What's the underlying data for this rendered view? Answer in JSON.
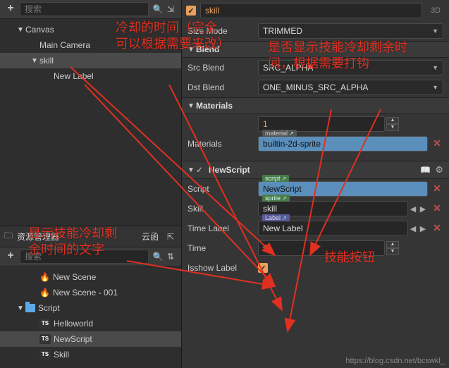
{
  "search": {
    "placeholder": "搜索"
  },
  "hierarchy": {
    "items": [
      {
        "label": "Canvas",
        "indent": 1,
        "caret": "▼"
      },
      {
        "label": "Main Camera",
        "indent": 2,
        "caret": ""
      },
      {
        "label": "skill",
        "indent": 2,
        "caret": "▼",
        "selected": true
      },
      {
        "label": "New Label",
        "indent": 3,
        "caret": ""
      }
    ]
  },
  "assets": {
    "panel_title": "资源管理器",
    "panel_tab2": "云函",
    "items": [
      {
        "label": "New Scene",
        "icon": "fire",
        "indent": 2
      },
      {
        "label": "New Scene - 001",
        "icon": "fire",
        "indent": 2
      },
      {
        "label": "Script",
        "icon": "folder",
        "indent": 1,
        "caret": "▼"
      },
      {
        "label": "Helloworld",
        "icon": "ts",
        "indent": 2
      },
      {
        "label": "NewScript",
        "icon": "ts",
        "indent": 2,
        "selected": true
      },
      {
        "label": "Skill",
        "icon": "ts",
        "indent": 2
      }
    ]
  },
  "inspector": {
    "node_name": "skill",
    "three_d": "3D",
    "size_mode": {
      "label": "Size Mode",
      "value": "TRIMMED"
    },
    "blend_section": "Blend",
    "src_blend": {
      "label": "Src Blend",
      "value": "SRC_ALPHA"
    },
    "dst_blend": {
      "label": "Dst Blend",
      "value": "ONE_MINUS_SRC_ALPHA"
    },
    "materials_section": "Materials",
    "materials_count": "1",
    "material_slot": {
      "label": "Materials",
      "tag": "material",
      "value": "builtin-2d-sprite"
    },
    "newscript_section": "NewScript",
    "script_prop": {
      "label": "Script",
      "tag": "script",
      "value": "NewScript"
    },
    "skill_prop": {
      "label": "Skill",
      "tag": "sprite",
      "value": "skill"
    },
    "timelabel_prop": {
      "label": "Time Label",
      "tag": "Label",
      "value": "New Label"
    },
    "time_prop": {
      "label": "Time",
      "value": "5"
    },
    "isshow_prop": {
      "label": "Isshow Label"
    }
  },
  "annotations": {
    "a1": "冷却的时间（完全可以根据需要来改）",
    "a2": "是否显示技能冷却剩余时间，根据需要打钩",
    "a3": "显示技能冷却剩余时间的文字",
    "a4": "技能按钮"
  },
  "watermark": "https://blog.csdn.net/bcswkl_"
}
